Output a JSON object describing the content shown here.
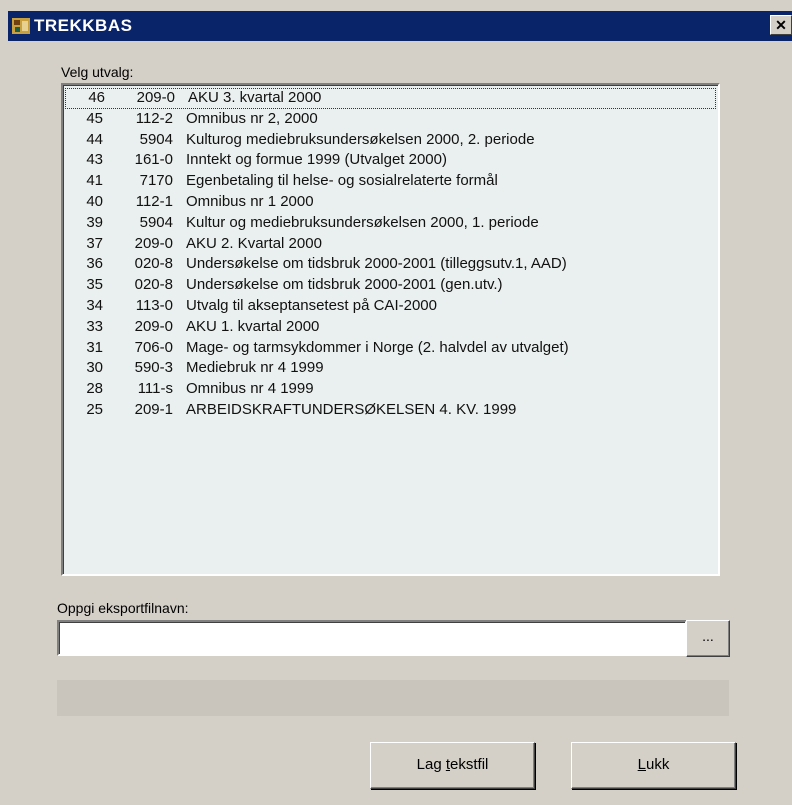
{
  "window": {
    "title": "TREKKBAS",
    "close_symbol": "✕"
  },
  "list": {
    "label": "Velg utvalg:",
    "items": [
      {
        "num": "46",
        "code": "209-0",
        "desc": "AKU 3. kvartal 2000"
      },
      {
        "num": "45",
        "code": "112-2",
        "desc": "Omnibus nr 2, 2000"
      },
      {
        "num": "44",
        "code": "5904",
        "desc": "Kulturog mediebruksundersøkelsen 2000, 2. periode"
      },
      {
        "num": "43",
        "code": "161-0",
        "desc": "Inntekt og formue 1999 (Utvalget 2000)"
      },
      {
        "num": "41",
        "code": "7170",
        "desc": "Egenbetaling til helse- og sosialrelaterte formål"
      },
      {
        "num": "40",
        "code": "112-1",
        "desc": "Omnibus nr 1 2000"
      },
      {
        "num": "39",
        "code": "5904",
        "desc": "Kultur og mediebruksundersøkelsen 2000, 1. periode"
      },
      {
        "num": "37",
        "code": "209-0",
        "desc": "AKU 2. Kvartal 2000"
      },
      {
        "num": "36",
        "code": "020-8",
        "desc": "Undersøkelse om tidsbruk 2000-2001 (tilleggsutv.1, AAD)"
      },
      {
        "num": "35",
        "code": "020-8",
        "desc": "Undersøkelse om tidsbruk 2000-2001 (gen.utv.)"
      },
      {
        "num": "34",
        "code": "113-0",
        "desc": "Utvalg til akseptansetest på CAI-2000"
      },
      {
        "num": "33",
        "code": "209-0",
        "desc": "AKU 1. kvartal 2000"
      },
      {
        "num": "31",
        "code": "706-0",
        "desc": "Mage- og tarmsykdommer i Norge (2. halvdel av utvalget)"
      },
      {
        "num": "30",
        "code": "590-3",
        "desc": "Mediebruk nr 4  1999"
      },
      {
        "num": "28",
        "code": "111-s",
        "desc": "Omnibus nr 4 1999"
      },
      {
        "num": "25",
        "code": "209-1",
        "desc": "ARBEIDSKRAFTUNDERSØKELSEN 4. KV. 1999"
      }
    ]
  },
  "export": {
    "label": "Oppgi eksportfilnavn:",
    "value": "",
    "browse_label": "..."
  },
  "progress": {
    "value": 0
  },
  "buttons": {
    "make_text_file": "Lag tekstfil",
    "close": "Lukk"
  }
}
